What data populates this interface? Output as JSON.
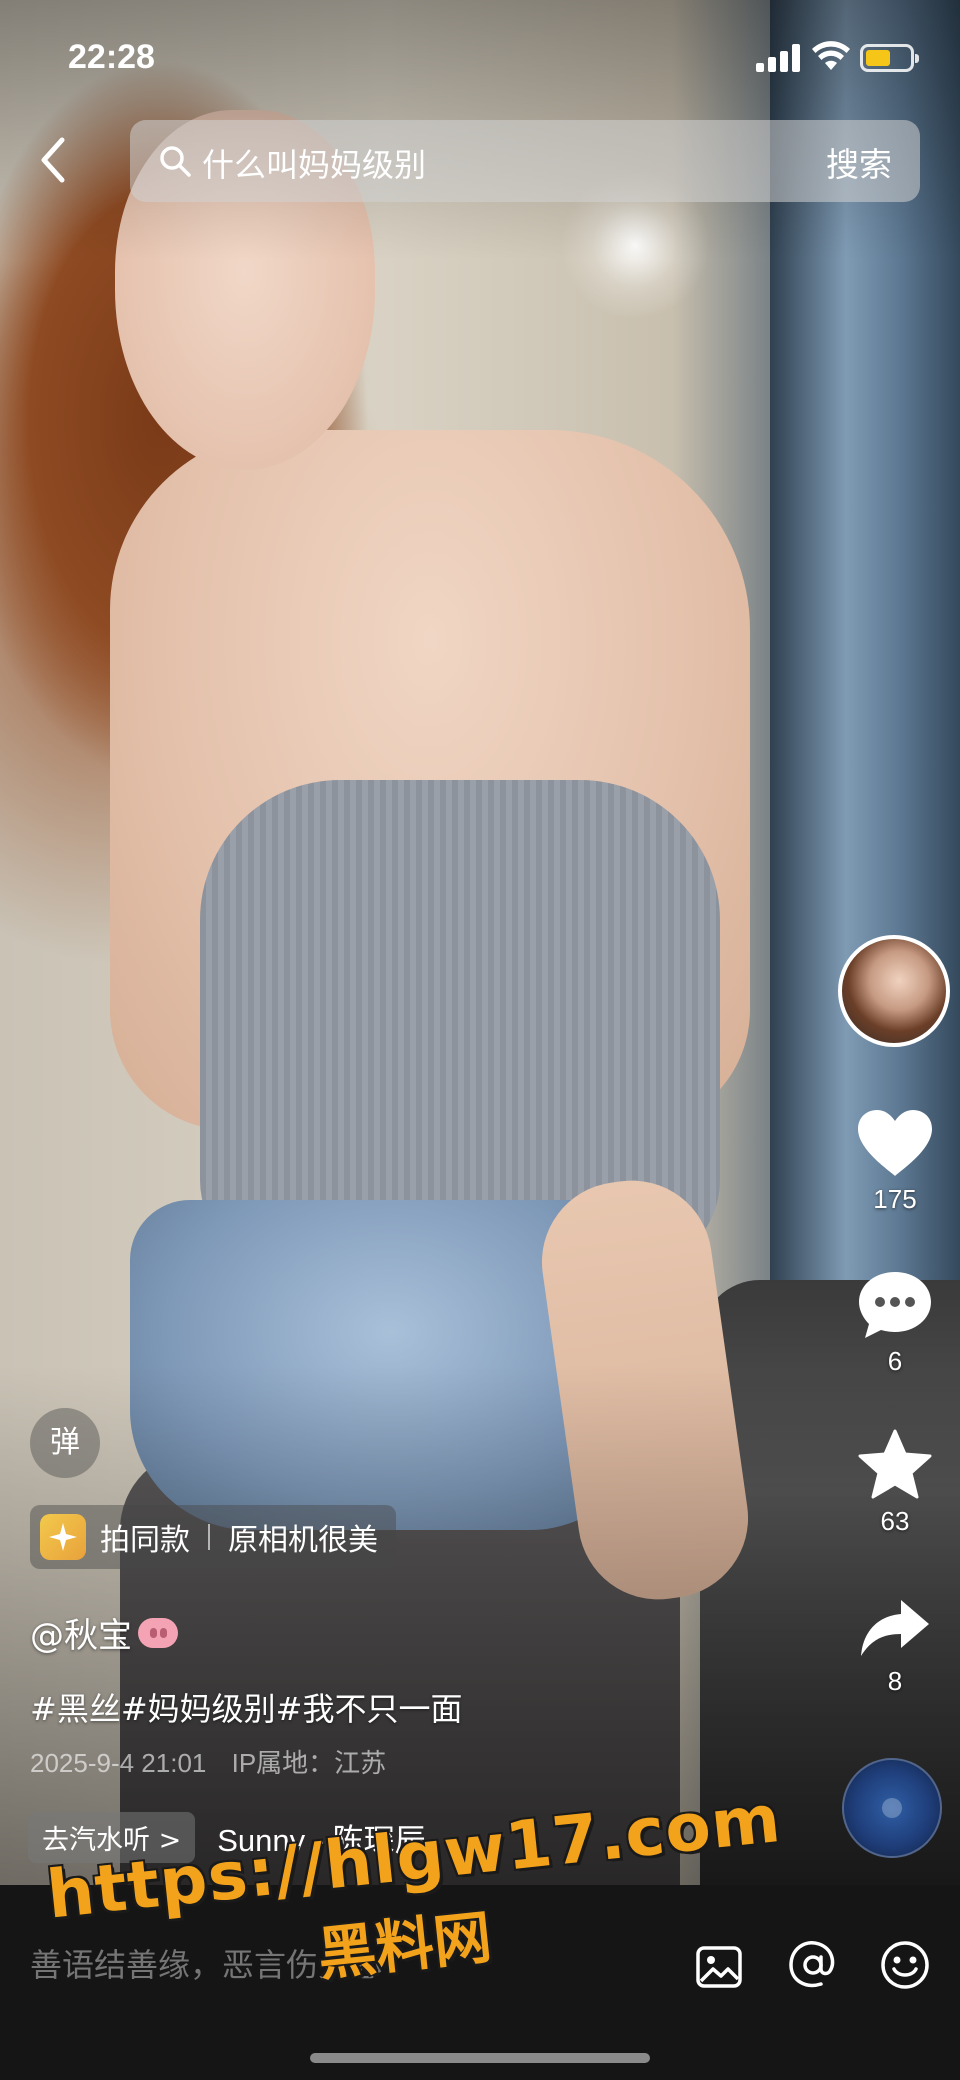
{
  "status_bar": {
    "time": "22:28",
    "battery_color": "#f5c518"
  },
  "header": {
    "back_icon": "chevron-left-icon",
    "search_icon": "search-icon",
    "search_query": "什么叫妈妈级别",
    "search_button_label": "搜索"
  },
  "actions": {
    "like_count": "175",
    "comment_count": "6",
    "favorite_count": "63",
    "share_count": "8",
    "like_icon": "heart-icon",
    "comment_icon": "comment-bubble-icon",
    "favorite_icon": "star-icon",
    "share_icon": "share-arrow-icon"
  },
  "overlay": {
    "danmu_label": "弹",
    "template_action_label": "拍同款",
    "template_effect_label": "原相机很美",
    "author_name": "@秋宝",
    "caption": "#黑丝#妈妈级别#我不只一面",
    "post_date": "2025-9-4 21:01",
    "ip_location": "IP属地：江苏",
    "music_chip_label": "去汽水听 >",
    "music_title": "Sunny - 陈琛辰"
  },
  "comment_bar": {
    "placeholder": "善语结善缘，恶言伤人心",
    "image_icon": "image-icon",
    "mention_icon": "at-mention-icon",
    "emoji_icon": "emoji-smile-icon"
  },
  "watermark": {
    "url": "https://hlgw17.com",
    "name": "黑料网",
    "color": "#f2a21b"
  }
}
